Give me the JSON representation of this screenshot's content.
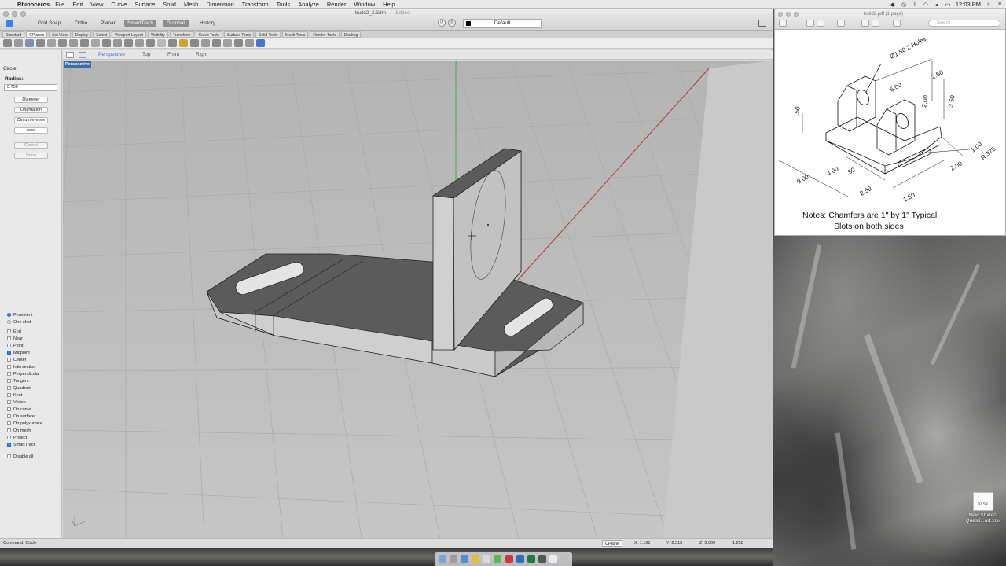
{
  "menubar": {
    "app_name": "Rhinoceros",
    "menus": [
      "File",
      "Edit",
      "View",
      "Curve",
      "Surface",
      "Solid",
      "Mesh",
      "Dimension",
      "Transform",
      "Tools",
      "Analyze",
      "Render",
      "Window",
      "Help"
    ],
    "clock": "12:03 PM"
  },
  "rhino": {
    "document_title": "build2_2.3dm",
    "edited_label": "— Edited",
    "modes": {
      "grid_snap": "Grid Snap",
      "ortho": "Ortho",
      "planar": "Planar",
      "smarttrack": "SmartTrack",
      "gumball": "Gumball",
      "history": "History"
    },
    "layer": "Default",
    "layer_color": "#000000",
    "toolbar_tabs": [
      "Standard",
      "CPlanes",
      "Set View",
      "Display",
      "Select",
      "Viewport Layout",
      "Visibility",
      "Transform",
      "Curve Tools",
      "Surface Tools",
      "Solid Tools",
      "Mesh Tools",
      "Render Tools",
      "Drafting"
    ],
    "view_tabs": {
      "perspective": "Perspective",
      "top": "Top",
      "front": "Front",
      "right": "Right"
    },
    "viewport_label": "Perspective",
    "command_panel": {
      "title": "Circle",
      "radius_label": "Radius:",
      "radius_value": "0.750",
      "options": {
        "diameter": "Diameter",
        "orientation": "Orientation",
        "circumference": "Circumference",
        "area": "Area",
        "cancel": "Cancel",
        "done": "Done"
      }
    },
    "snaps": {
      "persistent": "Persistent",
      "one_shot": "One shot",
      "end": "End",
      "near": "Near",
      "point": "Point",
      "midpoint": "Midpoint",
      "center": "Center",
      "intersection": "Intersection",
      "perpendicular": "Perpendicular",
      "tangent": "Tangent",
      "quadrant": "Quadrant",
      "knot": "Knot",
      "vertex": "Vertex",
      "on_curve": "On curve",
      "on_surface": "On surface",
      "on_polysurface": "On polysurface",
      "on_mesh": "On mesh",
      "project": "Project",
      "smarttrack": "SmartTrack",
      "disable_all": "Disable all"
    },
    "status": {
      "command": "Command: Circle",
      "cplane": "CPlane",
      "x": "X: 1.161",
      "y": "Y: 2.315",
      "z": "Z: 0.000",
      "value": "1.258"
    }
  },
  "preview": {
    "title": "build2.pdf (1 page)",
    "search_placeholder": "Search",
    "drawing": {
      "holes_label": "Ø1.50 2 Holes",
      "dim_250": "2.50",
      "dim_500": "5.00",
      "dim_200_top": "2.00",
      "dim_350": "3.50",
      "dim_50_left": ".50",
      "dim_100": "1.00",
      "dim_r375": "R.375",
      "dim_200_bottom": "2.00",
      "dim_900": "9.00",
      "dim_400": "4.00",
      "dim_50_mid": ".50",
      "dim_250_bottom": "2.50",
      "dim_150": "1.50"
    },
    "notes_line1": "Notes: Chamfers are 1\" by 1\" Typical",
    "notes_line2": "Slots on both sides"
  },
  "desktop": {
    "file_icon_label": "XLSX",
    "file_name_line1": "New Student",
    "file_name_line2": "Questi...ort.xlsx"
  }
}
